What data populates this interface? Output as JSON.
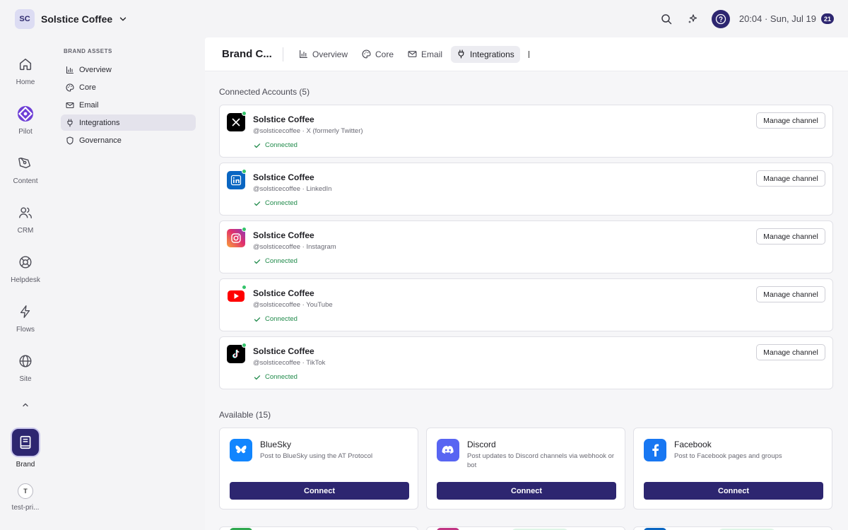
{
  "workspace": {
    "initials": "SC",
    "name": "Solstice Coffee"
  },
  "topbar": {
    "clock": "20:04 · Sun, Jul 19",
    "notifications": "21"
  },
  "rail": {
    "items": [
      {
        "label": "Home"
      },
      {
        "label": "Pilot"
      },
      {
        "label": "Content"
      },
      {
        "label": "CRM"
      },
      {
        "label": "Helpdesk"
      },
      {
        "label": "Flows"
      },
      {
        "label": "Site"
      }
    ],
    "brand_label": "Brand",
    "user_initial": "T",
    "user_label": "test-pri..."
  },
  "subnav": {
    "title": "BRAND ASSETS",
    "items": [
      {
        "label": "Overview",
        "icon": "bar-chart-icon"
      },
      {
        "label": "Core",
        "icon": "palette-icon"
      },
      {
        "label": "Email",
        "icon": "mail-icon"
      },
      {
        "label": "Integrations",
        "icon": "plug-icon",
        "active": true
      },
      {
        "label": "Governance",
        "icon": "shield-icon"
      }
    ]
  },
  "header": {
    "title": "Brand C...",
    "tabs": [
      {
        "label": "Overview"
      },
      {
        "label": "Core"
      },
      {
        "label": "Email"
      },
      {
        "label": "Integrations",
        "active": true
      }
    ]
  },
  "connected": {
    "title": "Connected Accounts (5)",
    "manage_label": "Manage channel",
    "accounts": [
      {
        "name": "Solstice Coffee",
        "handle": "@solsticecoffee · X (formerly Twitter)",
        "status": "Connected",
        "icon": "x-logo-icon",
        "color": "#000000"
      },
      {
        "name": "Solstice Coffee",
        "handle": "@solsticecoffee · LinkedIn",
        "status": "Connected",
        "icon": "linkedin-logo-icon",
        "color": "#0a66c2"
      },
      {
        "name": "Solstice Coffee",
        "handle": "@solsticecoffee · Instagram",
        "status": "Connected",
        "icon": "instagram-logo-icon",
        "color": "#e1306c"
      },
      {
        "name": "Solstice Coffee",
        "handle": "@solsticecoffee · YouTube",
        "status": "Connected",
        "icon": "youtube-logo-icon",
        "color": "#ff0000"
      },
      {
        "name": "Solstice Coffee",
        "handle": "@solsticecoffee · TikTok",
        "status": "Connected",
        "icon": "tiktok-logo-icon",
        "color": "#000000"
      }
    ]
  },
  "available": {
    "title": "Available (15)",
    "connect_label": "Connect",
    "items": [
      {
        "name": "BlueSky",
        "desc": "Post to BlueSky using the AT Protocol",
        "icon": "bluesky-logo-icon",
        "color": "#1185fe"
      },
      {
        "name": "Discord",
        "desc": "Post updates to Discord channels via webhook or bot",
        "icon": "discord-logo-icon",
        "color": "#5865f2"
      },
      {
        "name": "Facebook",
        "desc": "Post to Facebook pages and groups",
        "icon": "facebook-logo-icon",
        "color": "#1877f2"
      }
    ]
  },
  "colors": {
    "accent": "#2d2670",
    "connected": "#1f8a4a",
    "online_dot": "#34c36b"
  }
}
